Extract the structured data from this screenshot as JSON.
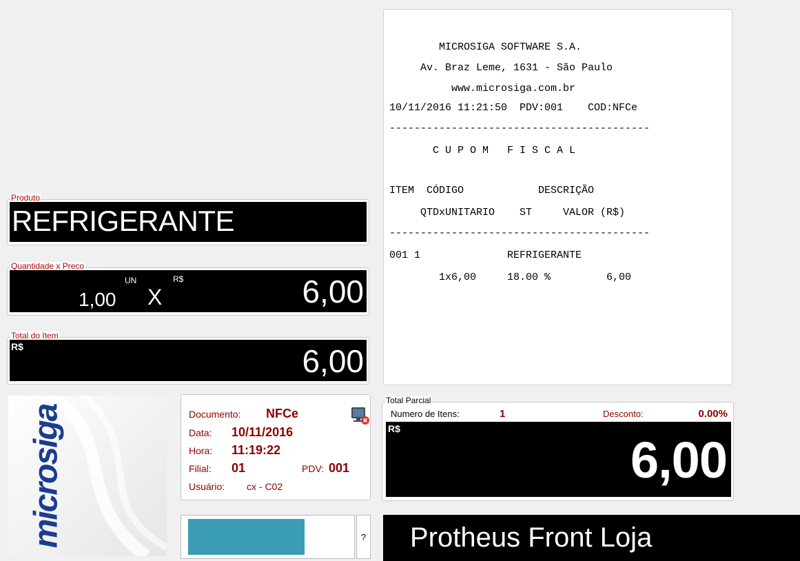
{
  "receipt": {
    "lines": [
      "        MICROSIGA SOFTWARE S.A.",
      "     Av. Braz Leme, 1631 - São Paulo",
      "          www.microsiga.com.br",
      "10/11/2016 11:21:50  PDV:001    COD:NFCe",
      "------------------------------------------",
      "       C U P O M   F I S C A L",
      "",
      "ITEM  CÓDIGO            DESCRIÇÃO",
      "     QTDxUNITARIO    ST     VALOR (R$)",
      "------------------------------------------",
      "001 1              REFRIGERANTE",
      "        1x6,00     18.00 %         6,00"
    ]
  },
  "produto": {
    "label": "Produto",
    "value": "REFRIGERANTE"
  },
  "qtd_preco": {
    "label": "Quantidade x Preco",
    "quantity": "1,00",
    "unit": "UN",
    "times": "X",
    "currency": "R$",
    "price": "6,00"
  },
  "total_item": {
    "label": "Total do Item",
    "currency": "R$",
    "value": "6,00"
  },
  "logo": {
    "text": "microsiga"
  },
  "info": {
    "documento_label": "Documento:",
    "documento_value": "NFCe",
    "data_label": "Data:",
    "data_value": "10/11/2016",
    "hora_label": "Hora:",
    "hora_value": "11:19:22",
    "filial_label": "Filial:",
    "filial_value": "01",
    "pdv_label": "PDV:",
    "pdv_value": "001",
    "usuario_label": "Usuário:",
    "usuario_value": "cx - C02"
  },
  "total_parcial": {
    "label": "Total Parcial",
    "itens_label": "Numero de Itens:",
    "itens_value": "1",
    "desconto_label": "Desconto:",
    "desconto_value": "0.00%",
    "currency": "R$",
    "value": "6,00"
  },
  "progress": {
    "fraction": 0.69,
    "help_label": "?"
  },
  "footer": {
    "title": "Protheus Front Loja"
  },
  "colors": {
    "accent": "#8b0000",
    "progress": "#3a9db5",
    "display_bg": "#000000"
  }
}
